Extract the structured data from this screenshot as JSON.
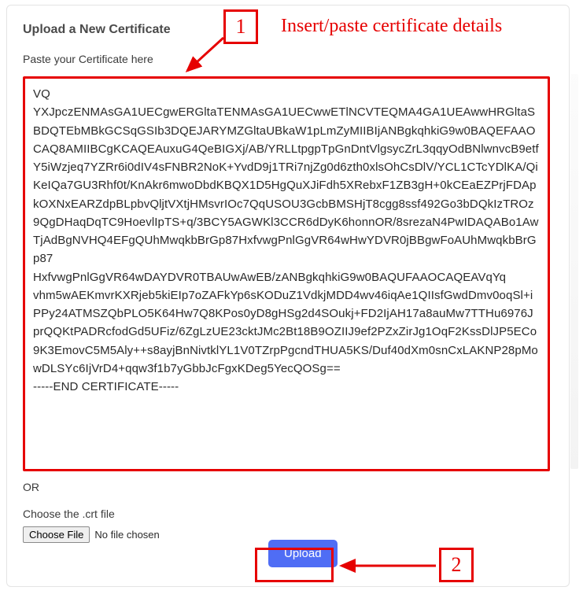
{
  "title": "Upload a New Certificate",
  "paste_label": "Paste your Certificate here",
  "certificate_text": "VQ\nYXJpczENMAsGA1UECgwERGltaTENMAsGA1UECwwETlNCVTEQMA4GA1UEAwwHRGltaSBDQTEbMBkGCSqGSIb3DQEJARYMZGltaUBkaW1pLmZyMIIBIjANBgkqhkiG9w0BAQEFAAOCAQ8AMIIBCgKCAQEAuxuG4QeBIGXj/AB/YRLLtpgpTpGnDntVlgsycZrL3qqyOdBNlwnvcB9etfY5iWzjeq7YZRr6i0dIV4sFNBR2NoK+YvdD9j1TRi7njZg0d6zth0xlsOhCsDlV/YCL1CTcYDlKA/QiKeIQa7GU3Rhf0t/KnAkr6mwoDbdKBQX1D5HgQuXJiFdh5XRebxF1ZB3gH+0kCEaEZPrjFDApkOXNxEARZdpBLpbvQljtVXtjHMsvrIOc7QqUSOU3GcbBMSHjT8cgg8ssf492Go3bDQkIzTROz9QgDHaqDqTC9HoevlIpTS+q/3BCY5AGWKl3CCR6dDyK6honnOR/8srezaN4PwIDAQABo1AwTjAdBgNVHQ4EFgQUhMwqkbBrGp87HxfvwgPnlGgVR64wHwYDVR0jBBgwFoAUhMwqkbBrGp87\nHxfvwgPnlGgVR64wDAYDVR0TBAUwAwEB/zANBgkqhkiG9w0BAQUFAAOCAQEAVqYq\nvhm5wAEKmvrKXRjeb5kiEIp7oZAFkYp6sKODuZ1VdkjMDD4wv46iqAe1QIIsfGwdDmv0oqSl+iPPy24ATMSZQbPLO5K64Hw7Q8KPos0yD8gHSg2d4SOukj+FD2IjAH17a8auMw7TTHu6976JprQQKtPADRcfodGd5UFiz/6ZgLzUE23cktJMc2Bt18B9OZIIJ9ef2PZxZirJg1OqF2KssDlJP5ECo9K3EmovC5M5Aly++s8ayjBnNivtklYL1V0TZrpPgcndTHUA5KS/Duf40dXm0snCxLAKNP28pMowDLSYc6IjVrD4+qqw3f1b7yGbbJcFgxKDeg5YecQOSg==\n-----END CERTIFICATE-----",
  "or_text": "OR",
  "choose_file_label": "Choose the .crt file",
  "choose_file_button": "Choose File",
  "file_status": "No file chosen",
  "upload_button": "Upload",
  "annotations": {
    "step1_num": "1",
    "step2_num": "2",
    "step1_text": "Insert/paste certificate details"
  }
}
